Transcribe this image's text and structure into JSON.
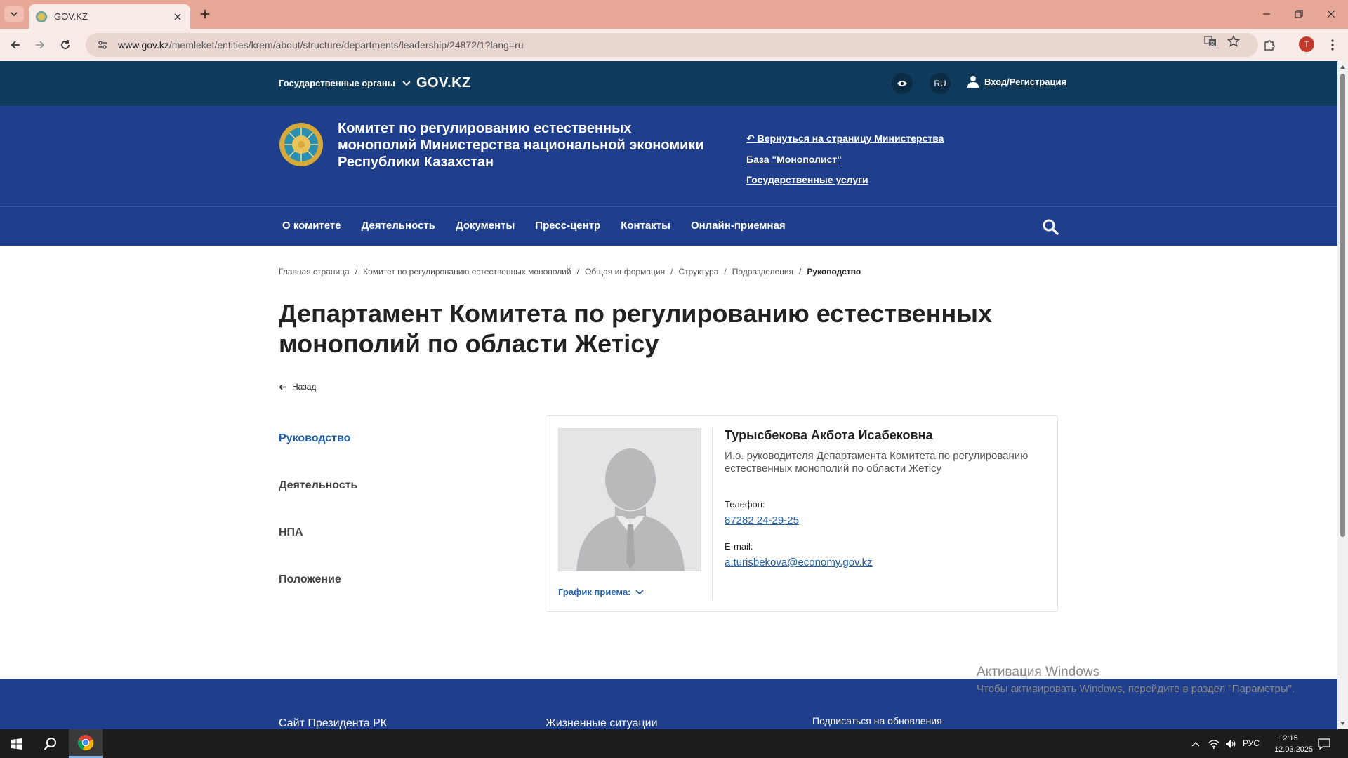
{
  "browser": {
    "tab_title": "GOV.KZ",
    "url_host": "www.gov.kz",
    "url_path": "/memleket/entities/krem/about/structure/departments/leadership/24872/1?lang=ru",
    "profile_initial": "T"
  },
  "topbar": {
    "gov_dropdown": "Государственные органы",
    "site_name": "GOV.KZ",
    "lang": "RU",
    "login": "Вход",
    "register": "Регистрация",
    "login_sep": "/"
  },
  "header": {
    "org_name": "Комитет по регулированию естественных монополий Министерства национальной экономики Республики Казахстан",
    "links": [
      "↶ Вернуться на страницу Министерства",
      "База \"Монополист\"",
      "Государственные услуги"
    ]
  },
  "nav": {
    "items": [
      "О комитете",
      "Деятельность",
      "Документы",
      "Пресс-центр",
      "Контакты",
      "Онлайн-приемная"
    ]
  },
  "breadcrumb": {
    "items": [
      "Главная страница",
      "Комитет по регулированию естественных монополий",
      "Общая информация",
      "Структура",
      "Подразделения"
    ],
    "current": "Руководство",
    "sep": "/"
  },
  "page": {
    "title": "Департамент Комитета по регулированию естественных монополий по области Жетісу",
    "back": "Назад"
  },
  "side_menu": {
    "items": [
      "Руководство",
      "Деятельность",
      "НПА",
      "Положение"
    ]
  },
  "person": {
    "name": "Турысбекова Акбота Исабековна",
    "position": "И.о. руководителя Департамента Комитета по регулированию естественных монополий по области Жетісу",
    "phone_label": "Телефон:",
    "phone": "87282 24-29-25",
    "email_label": "E-mail:",
    "email": "a.turisbekova@economy.gov.kz",
    "schedule": "График приема:"
  },
  "footer": {
    "col1": "Сайт Президента РК",
    "col2": "Жизненные ситуации",
    "subscribe": "Подписаться на обновления"
  },
  "windows": {
    "activation_title": "Активация Windows",
    "activation_text": "Чтобы активировать Windows, перейдите в раздел \"Параметры\".",
    "lang": "РУС",
    "time": "12:15",
    "date": "12.03.2025"
  },
  "colors": {
    "topbar": "#0f3a5b",
    "header": "#1f3e8c",
    "link": "#1f5fae",
    "tabbar": "#e8a898"
  }
}
